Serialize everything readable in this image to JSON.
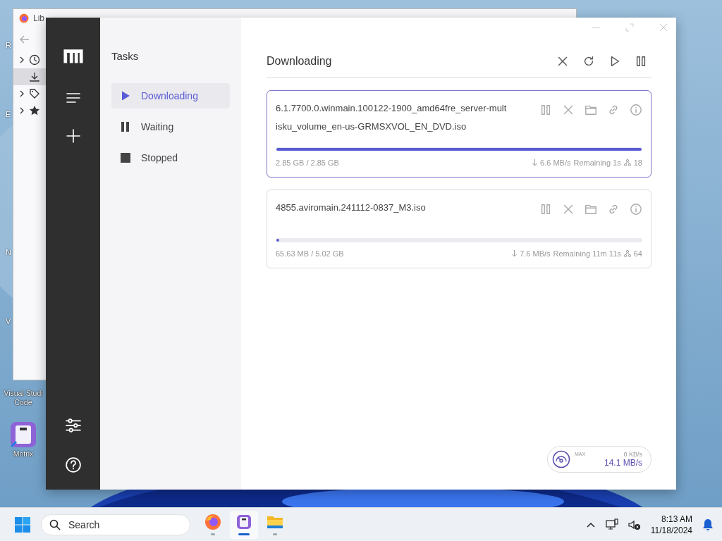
{
  "desktop": {
    "edge_letters": [
      "R",
      "E",
      "N",
      "V"
    ],
    "icons": [
      {
        "kind": "vscode",
        "lines": [
          "Visual Studi",
          "Code"
        ]
      },
      {
        "kind": "motrix",
        "lines": [
          "Motrix"
        ]
      }
    ]
  },
  "background_window": {
    "title": "Lib",
    "tree": [
      {
        "kind": "clock",
        "selected": false,
        "expandable": true
      },
      {
        "kind": "download",
        "selected": true,
        "expandable": false
      },
      {
        "kind": "tag",
        "selected": false,
        "expandable": true
      },
      {
        "kind": "star",
        "selected": false,
        "expandable": true
      }
    ]
  },
  "app": {
    "panel": {
      "title": "Tasks",
      "items": [
        {
          "label": "Downloading",
          "kind": "play",
          "selected": true
        },
        {
          "label": "Waiting",
          "kind": "pause",
          "selected": false
        },
        {
          "label": "Stopped",
          "kind": "stop",
          "selected": false
        }
      ]
    },
    "main": {
      "title": "Downloading",
      "tasks": [
        {
          "name": "6.1.7700.0.winmain.100122-1900_amd64fre_server-multisku_volume_en-us-GRMSXVOL_EN_DVD.iso",
          "selected": true,
          "level": 1,
          "size": "2.85 GB / 2.85 GB",
          "speed": "6.6 MB/s",
          "remaining": "Remaining 1s",
          "connections": "18"
        },
        {
          "name": "4855.aviromain.241112-0837_M3.iso",
          "selected": false,
          "level": 0.006,
          "size": "65.63 MB / 5.02 GB",
          "speed": "7.6 MB/s",
          "remaining": "Remaining 11m 11s",
          "connections": "64"
        }
      ],
      "speed": {
        "label": "MAX",
        "upload": "0 KB/s",
        "download": "14.1 MB/s"
      }
    }
  },
  "taskbar": {
    "search": {
      "placeholder": "Search"
    },
    "apps": [
      {
        "kind": "firefox",
        "active": false
      },
      {
        "kind": "motrix",
        "active": true
      },
      {
        "kind": "folder",
        "active": false
      }
    ],
    "time": "8:13 AM",
    "date": "11/18/2024"
  }
}
